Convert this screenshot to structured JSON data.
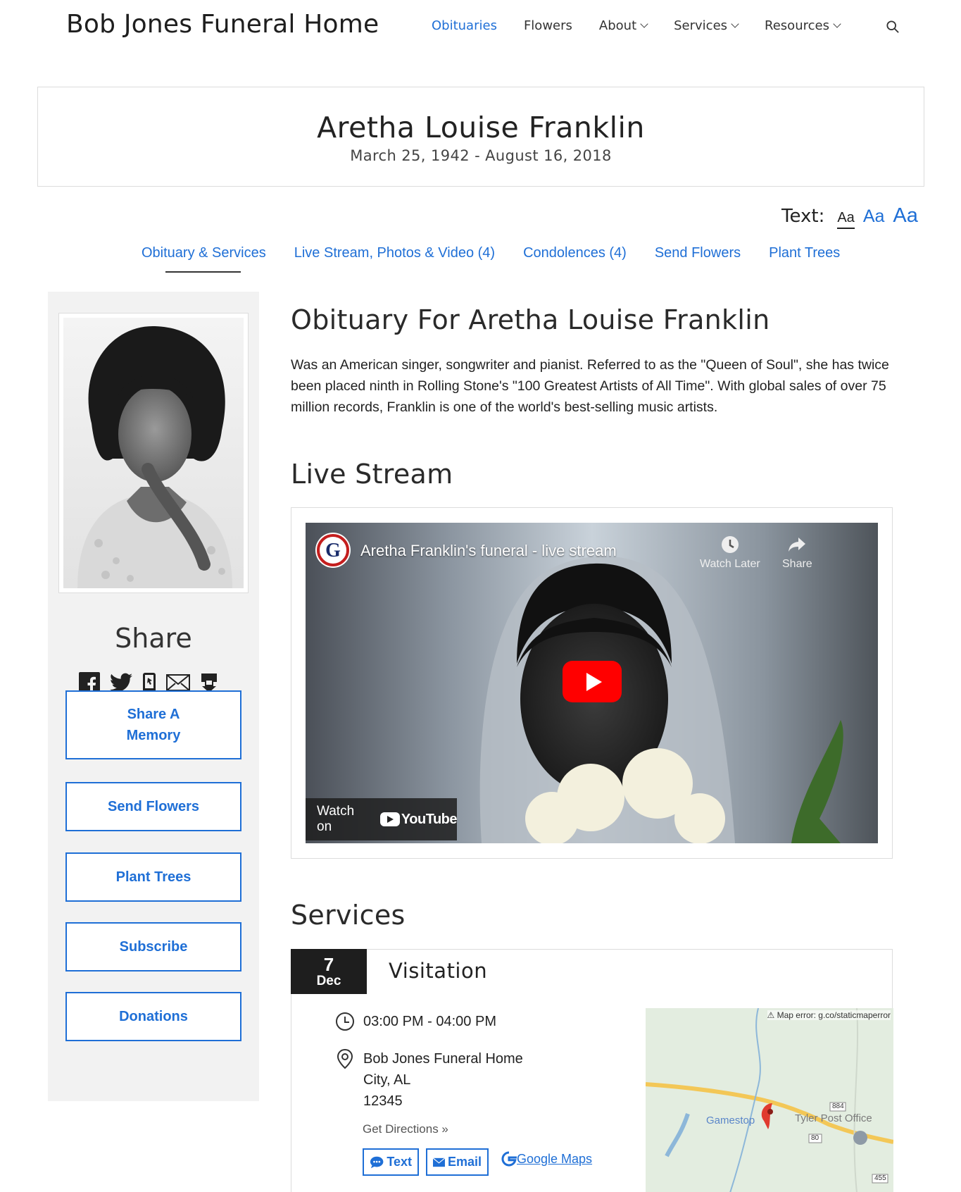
{
  "header": {
    "site_title": "Bob Jones Funeral Home",
    "nav": [
      {
        "label": "Obituaries",
        "active": true,
        "dropdown": false
      },
      {
        "label": "Flowers",
        "active": false,
        "dropdown": false
      },
      {
        "label": "About",
        "active": false,
        "dropdown": true
      },
      {
        "label": "Services",
        "active": false,
        "dropdown": true
      },
      {
        "label": "Resources",
        "active": false,
        "dropdown": true
      }
    ],
    "search_icon": "search-icon"
  },
  "person": {
    "name": "Aretha Louise Franklin",
    "dates": "March 25, 1942 - August 16, 2018"
  },
  "text_size": {
    "label": "Text:",
    "options": [
      "Aa",
      "Aa",
      "Aa"
    ]
  },
  "tabs": [
    "Obituary & Services",
    "Live Stream, Photos & Video (4)",
    "Condolences (4)",
    "Send Flowers",
    "Plant Trees"
  ],
  "sidebar": {
    "share_title": "Share",
    "share_icons": [
      "facebook-icon",
      "twitter-icon",
      "mobile-icon",
      "email-icon",
      "print-icon"
    ],
    "buttons": [
      "Share A Memory",
      "Send Flowers",
      "Plant Trees",
      "Subscribe",
      "Donations"
    ]
  },
  "obituary": {
    "heading": "Obituary For Aretha Louise Franklin",
    "text": "Was an American singer, songwriter and pianist. Referred to as the \"Queen of Soul\", she has twice been placed ninth in Rolling Stone's \"100 Greatest Artists of All Time\". With global sales of over 75 million records, Franklin is one of the world's best-selling music artists."
  },
  "live_stream": {
    "heading": "Live Stream",
    "video_title": "Aretha Franklin's funeral - live stream",
    "watch_later": "Watch Later",
    "share": "Share",
    "watch_on": "Watch on",
    "youtube": "YouTube",
    "channel_logo": "G"
  },
  "services": {
    "heading": "Services",
    "items": [
      {
        "day": "7",
        "month": "Dec",
        "title": "Visitation",
        "time": "03:00 PM - 04:00 PM",
        "location_name": "Bob Jones Funeral Home",
        "city": "City, AL",
        "zip": "12345",
        "get_directions": "Get Directions »",
        "text_btn": "Text",
        "email_btn": "Email",
        "google_maps": "Google Maps",
        "map": {
          "error": "Map error: g.co/staticmaperror",
          "label_gamestop": "Gamestop",
          "label_tyler": "Tyler Post Office",
          "shield_884": "884",
          "shield_80": "80",
          "shield_455": "455"
        }
      }
    ]
  },
  "colors": {
    "accent": "#1f6fd6",
    "sidebar_bg": "#f2f2f2",
    "date_badge": "#1e1e1e",
    "youtube_red": "#ff0000"
  }
}
